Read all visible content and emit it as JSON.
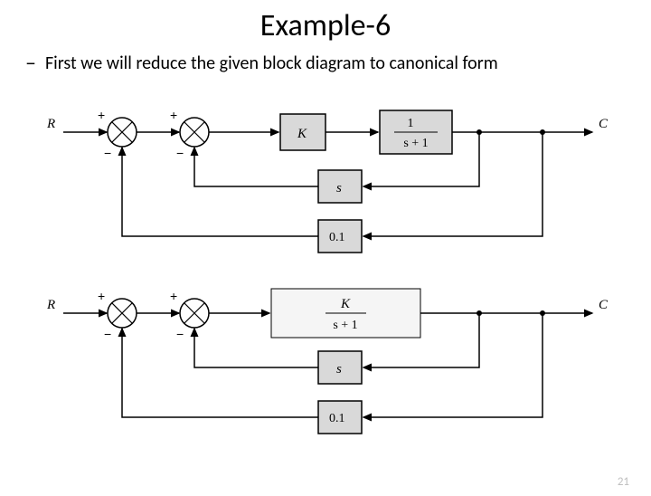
{
  "slide": {
    "title": "Example-6",
    "bullet": "First we will reduce the given block diagram to canonical form",
    "page_number": "21"
  },
  "diagram1": {
    "input_label": "R",
    "output_label": "C",
    "sum1_top": "+",
    "sum1_bot": "−",
    "sum2_top": "+",
    "sum2_bot": "−",
    "block_K": "K",
    "block_tf_num": "1",
    "block_tf_den": "s + 1",
    "block_h1": "s",
    "block_h2": "0.1"
  },
  "diagram2": {
    "input_label": "R",
    "output_label": "C",
    "sum1_top": "+",
    "sum1_bot": "−",
    "sum2_top": "+",
    "sum2_bot": "−",
    "block_tf_num": "K",
    "block_tf_den": "s + 1",
    "block_h1": "s",
    "block_h2": "0.1"
  }
}
